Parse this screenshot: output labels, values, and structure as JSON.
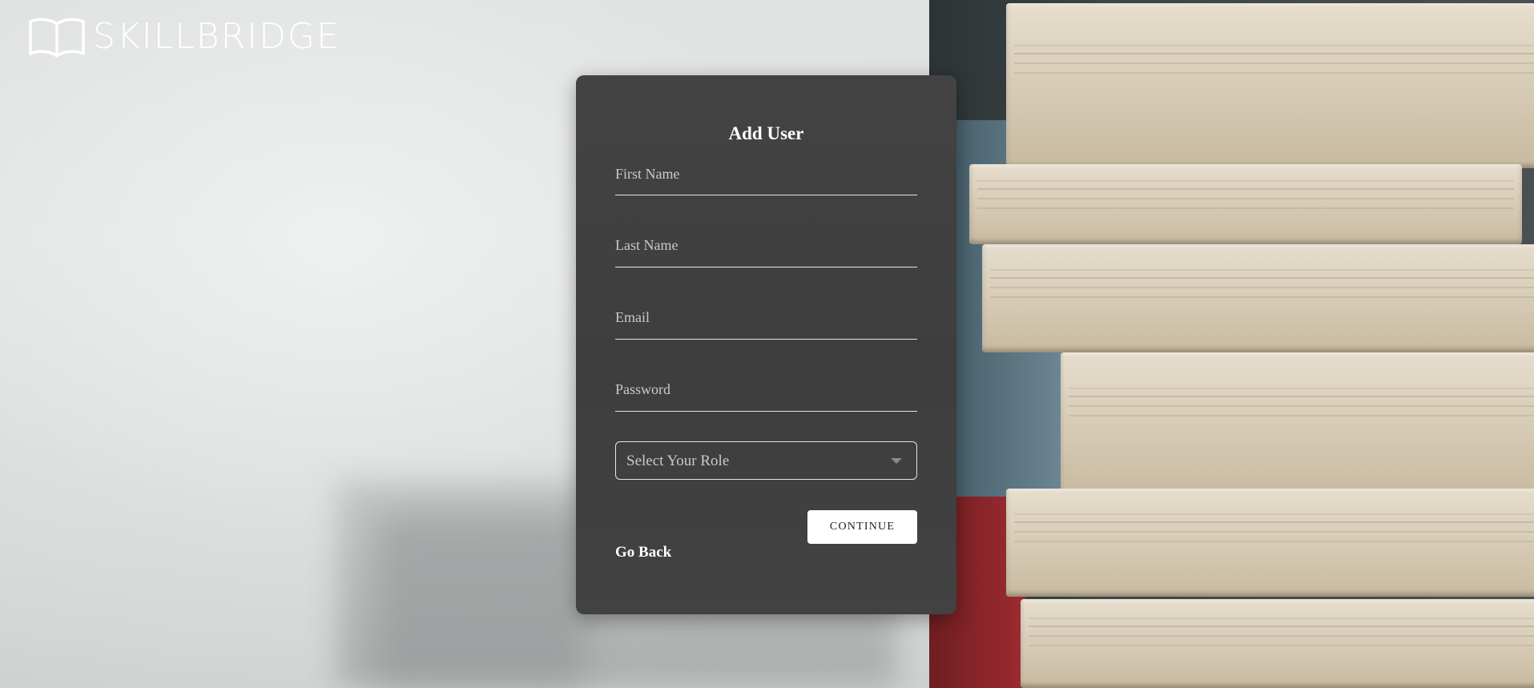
{
  "brand": {
    "name": "SKILLBRIDGE",
    "icon": "open-book-icon"
  },
  "form": {
    "title": "Add User",
    "fields": {
      "first_name": {
        "placeholder": "First Name",
        "value": ""
      },
      "last_name": {
        "placeholder": "Last Name",
        "value": ""
      },
      "email": {
        "placeholder": "Email",
        "value": ""
      },
      "password": {
        "placeholder": "Password",
        "value": ""
      }
    },
    "role_select": {
      "selected": "Select Your Role"
    },
    "continue_label": "CONTINUE",
    "go_back_label": "Go Back"
  },
  "colors": {
    "card_background": "#414241",
    "button_background": "#ffffff",
    "text_light": "#ffffff",
    "placeholder": "#c9c9c9"
  }
}
